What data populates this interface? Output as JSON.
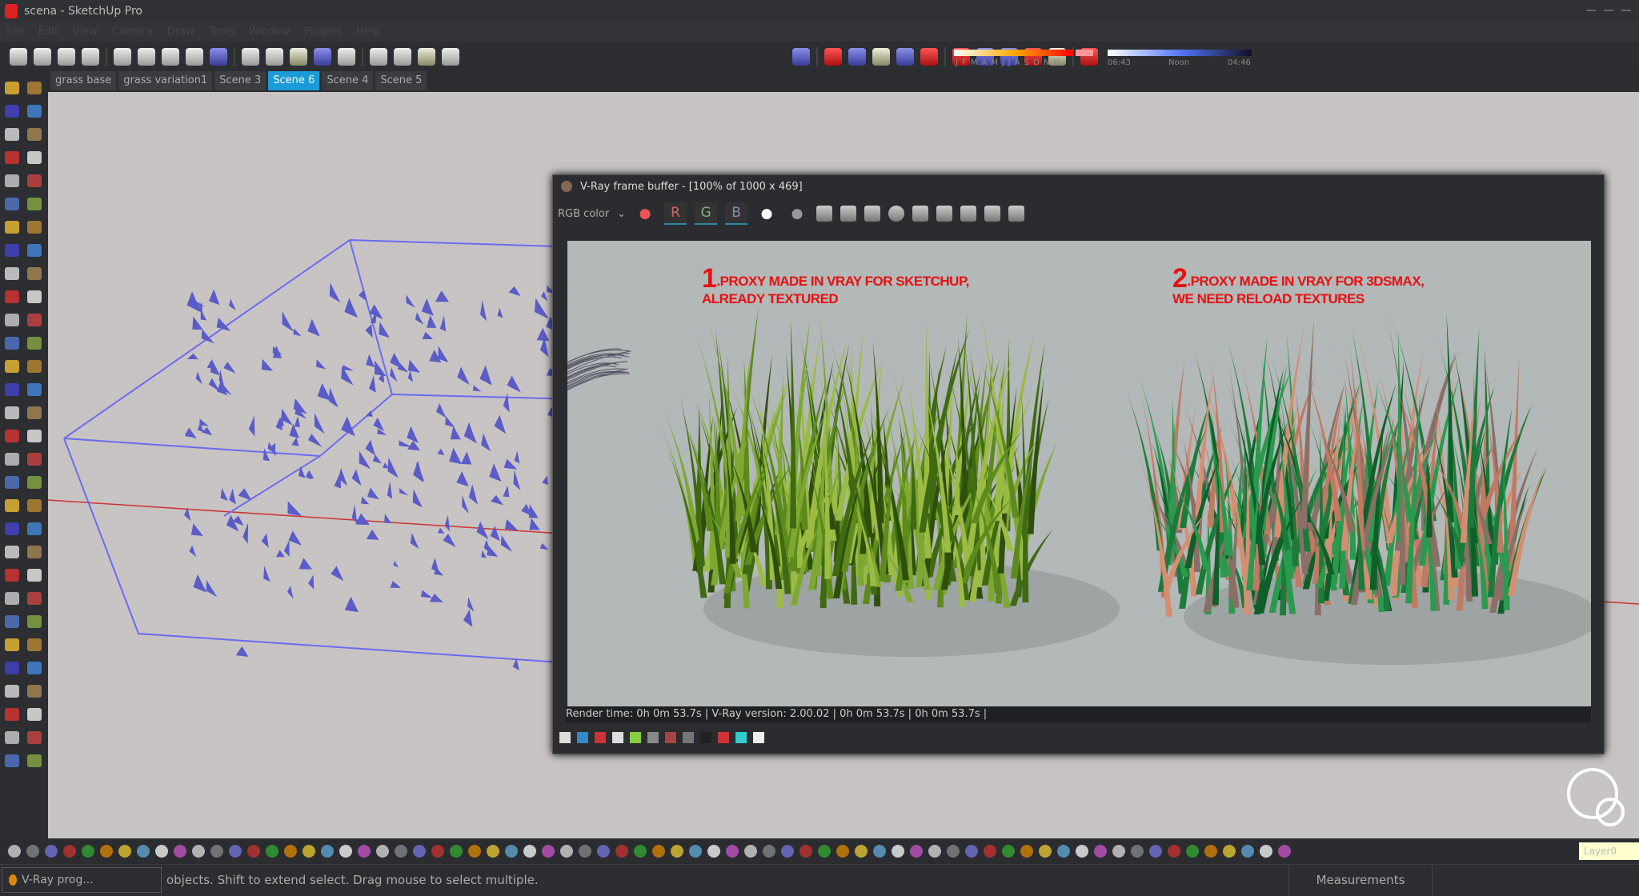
{
  "window": {
    "title": "scena - SketchUp Pro"
  },
  "menu": [
    "File",
    "Edit",
    "View",
    "Camera",
    "Draw",
    "Tools",
    "Window",
    "Plugins",
    "Help"
  ],
  "shadow_settings": {
    "months": [
      "J",
      "F",
      "M",
      "A",
      "M",
      "J",
      "J",
      "A",
      "S",
      "O",
      "N",
      "D"
    ],
    "time_start": "06:43",
    "time_mid": "Noon",
    "time_end": "04:46"
  },
  "scenes": [
    {
      "label": "grass base"
    },
    {
      "label": "grass variation1"
    },
    {
      "label": "Scene 3"
    },
    {
      "label": "Scene 6",
      "active": true
    },
    {
      "label": "Scene 4"
    },
    {
      "label": "Scene 5"
    }
  ],
  "layer": "Layer0",
  "status": {
    "vray_progress": "V-Ray prog...",
    "hint": "objects. Shift to extend select. Drag mouse to select multiple.",
    "measurements_label": "Measurements"
  },
  "vray": {
    "title": "V-Ray frame buffer - [100% of 1000 x 469]",
    "channel": "RGB color",
    "r": "R",
    "g": "G",
    "b": "B",
    "caption1": {
      "num": "1",
      "line1": ".PROXY MADE IN VRAY FOR SKETCHUP,",
      "line2": "ALREADY TEXTURED"
    },
    "caption2": {
      "num": "2",
      "line1": ".PROXY MADE IN VRAY FOR 3DSMAX,",
      "line2": "WE NEED RELOAD TEXTURES"
    },
    "status": "Render time:  0h  0m 53.7s | V-Ray version: 2.00.02 |  0h  0m 53.7s |  0h  0m 53.7s |"
  },
  "colors": {
    "accent": "#1a9ad6",
    "caption": "#e81010",
    "wire": "#6a6cf0"
  }
}
